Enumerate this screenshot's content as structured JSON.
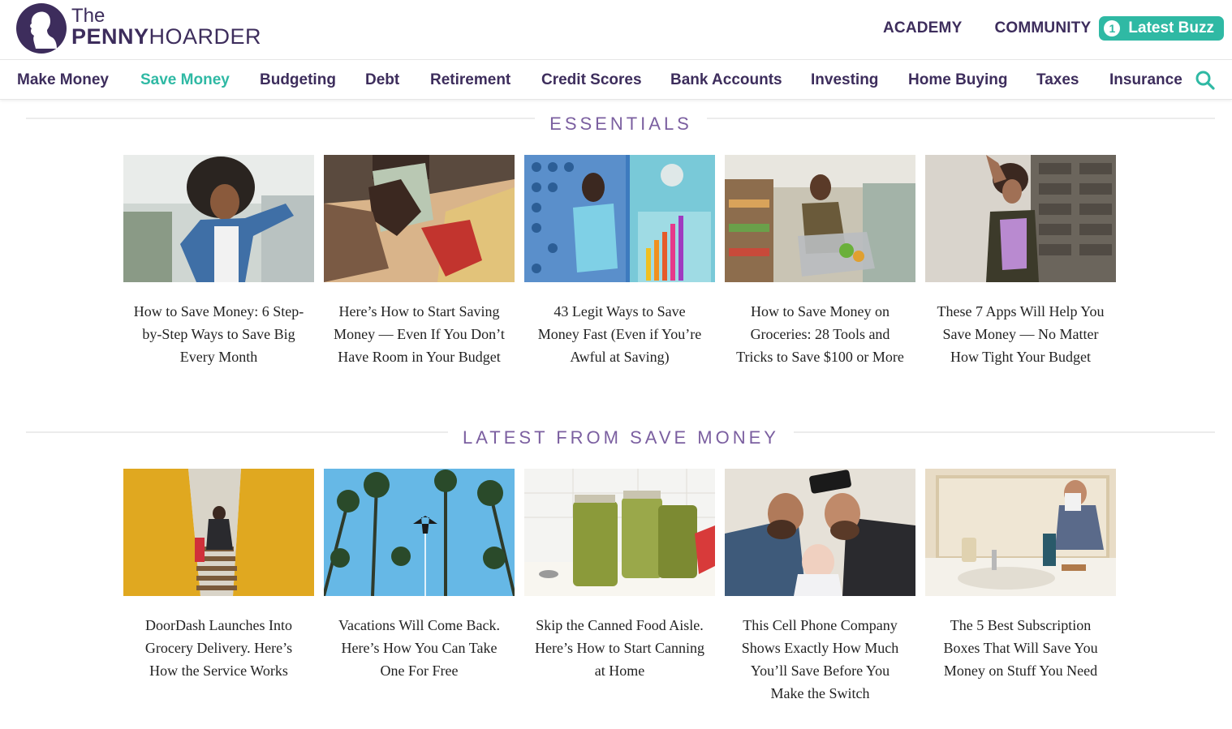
{
  "header": {
    "logo": {
      "the": "The",
      "penny": "PENNY",
      "hoarder": "HOARDER"
    },
    "links": [
      {
        "label": "ACADEMY"
      },
      {
        "label": "COMMUNITY"
      }
    ],
    "buzz": {
      "count": "1",
      "label": "Latest Buzz"
    },
    "colors": {
      "brand": "#3d2d5c",
      "accent": "#2fb9a4",
      "section": "#7b5fa0"
    }
  },
  "nav": {
    "items": [
      {
        "label": "Make Money"
      },
      {
        "label": "Save Money",
        "active": true
      },
      {
        "label": "Budgeting"
      },
      {
        "label": "Debt"
      },
      {
        "label": "Retirement"
      },
      {
        "label": "Credit Scores"
      },
      {
        "label": "Bank Accounts"
      },
      {
        "label": "Investing"
      },
      {
        "label": "Home Buying"
      },
      {
        "label": "Taxes"
      },
      {
        "label": "Insurance"
      }
    ],
    "search_icon": "search-icon"
  },
  "essentials": {
    "title": "ESSENTIALS",
    "cards": [
      {
        "title": "How to Save Money: 6 Step-by-Step Ways to Save Big Every Month",
        "image": "woman-dancing-denim-jacket"
      },
      {
        "title": "Here’s How to Start Saving Money — Even If You Don’t Have Room in Your Budget",
        "image": "hands-counting-cash"
      },
      {
        "title": "43 Legit Ways to Save Money Fast (Even if You’re Awful at Saving)",
        "image": "man-rich-tank-balance-meter"
      },
      {
        "title": "How to Save Money on Groceries: 28 Tools and Tricks to Save $100 or More",
        "image": "woman-grocery-cart"
      },
      {
        "title": "These 7 Apps Will Help You Save Money — No Matter How Tight Your Budget",
        "image": "woman-stone-wall-phone"
      }
    ]
  },
  "latest": {
    "title": "LATEST FROM SAVE MONEY",
    "cards": [
      {
        "title": "DoorDash Launches Into Grocery Delivery. Here’s How the Service Works",
        "image": "man-climbing-stairs-yellow"
      },
      {
        "title": "Vacations Will Come Back. Here’s How You Can Take One For Free",
        "image": "plane-over-palm-trees"
      },
      {
        "title": "Skip the Canned Food Aisle. Here’s How to Start Canning at Home",
        "image": "pickled-green-beans-jars"
      },
      {
        "title": "This Cell Phone Company Shows Exactly How Much You’ll Save Before You Make the Switch",
        "image": "dads-selfie-with-baby"
      },
      {
        "title": "The 5 Best Subscription Boxes That Will Save You Money on Stuff You Need",
        "image": "man-bathroom-sink-shaving"
      }
    ]
  }
}
